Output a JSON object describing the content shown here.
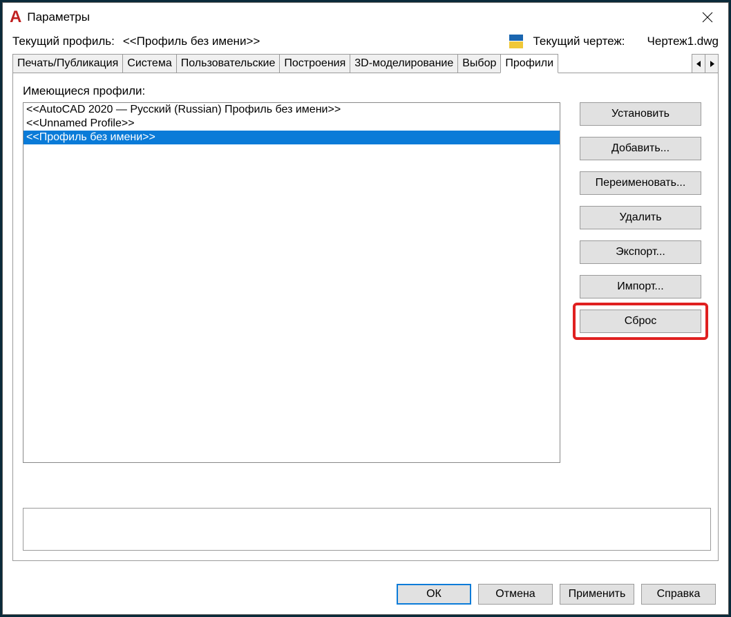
{
  "window": {
    "title": "Параметры"
  },
  "header": {
    "currentProfileLabel": "Текущий профиль:",
    "currentProfileValue": "<<Профиль без имени>>",
    "currentDrawingLabel": "Текущий чертеж:",
    "currentDrawingValue": "Чертеж1.dwg"
  },
  "tabs": {
    "items": [
      {
        "label": "Печать/Публикация"
      },
      {
        "label": "Система"
      },
      {
        "label": "Пользовательские"
      },
      {
        "label": "Построения"
      },
      {
        "label": "3D-моделирование"
      },
      {
        "label": "Выбор"
      },
      {
        "label": "Профили"
      }
    ],
    "activeIndex": 6
  },
  "profiles": {
    "listLabel": "Имеющиеся профили:",
    "items": [
      {
        "label": "<<AutoCAD 2020 — Русский (Russian) Профиль без имени>>",
        "selected": false
      },
      {
        "label": "<<Unnamed Profile>>",
        "selected": false
      },
      {
        "label": "<<Профиль без имени>>",
        "selected": true
      }
    ]
  },
  "sideButtons": {
    "set": "Установить",
    "add": "Добавить...",
    "rename": "Переименовать...",
    "delete": "Удалить",
    "export": "Экспорт...",
    "import": "Импорт...",
    "reset": "Сброс"
  },
  "footer": {
    "ok": "ОК",
    "cancel": "Отмена",
    "apply": "Применить",
    "help": "Справка"
  }
}
